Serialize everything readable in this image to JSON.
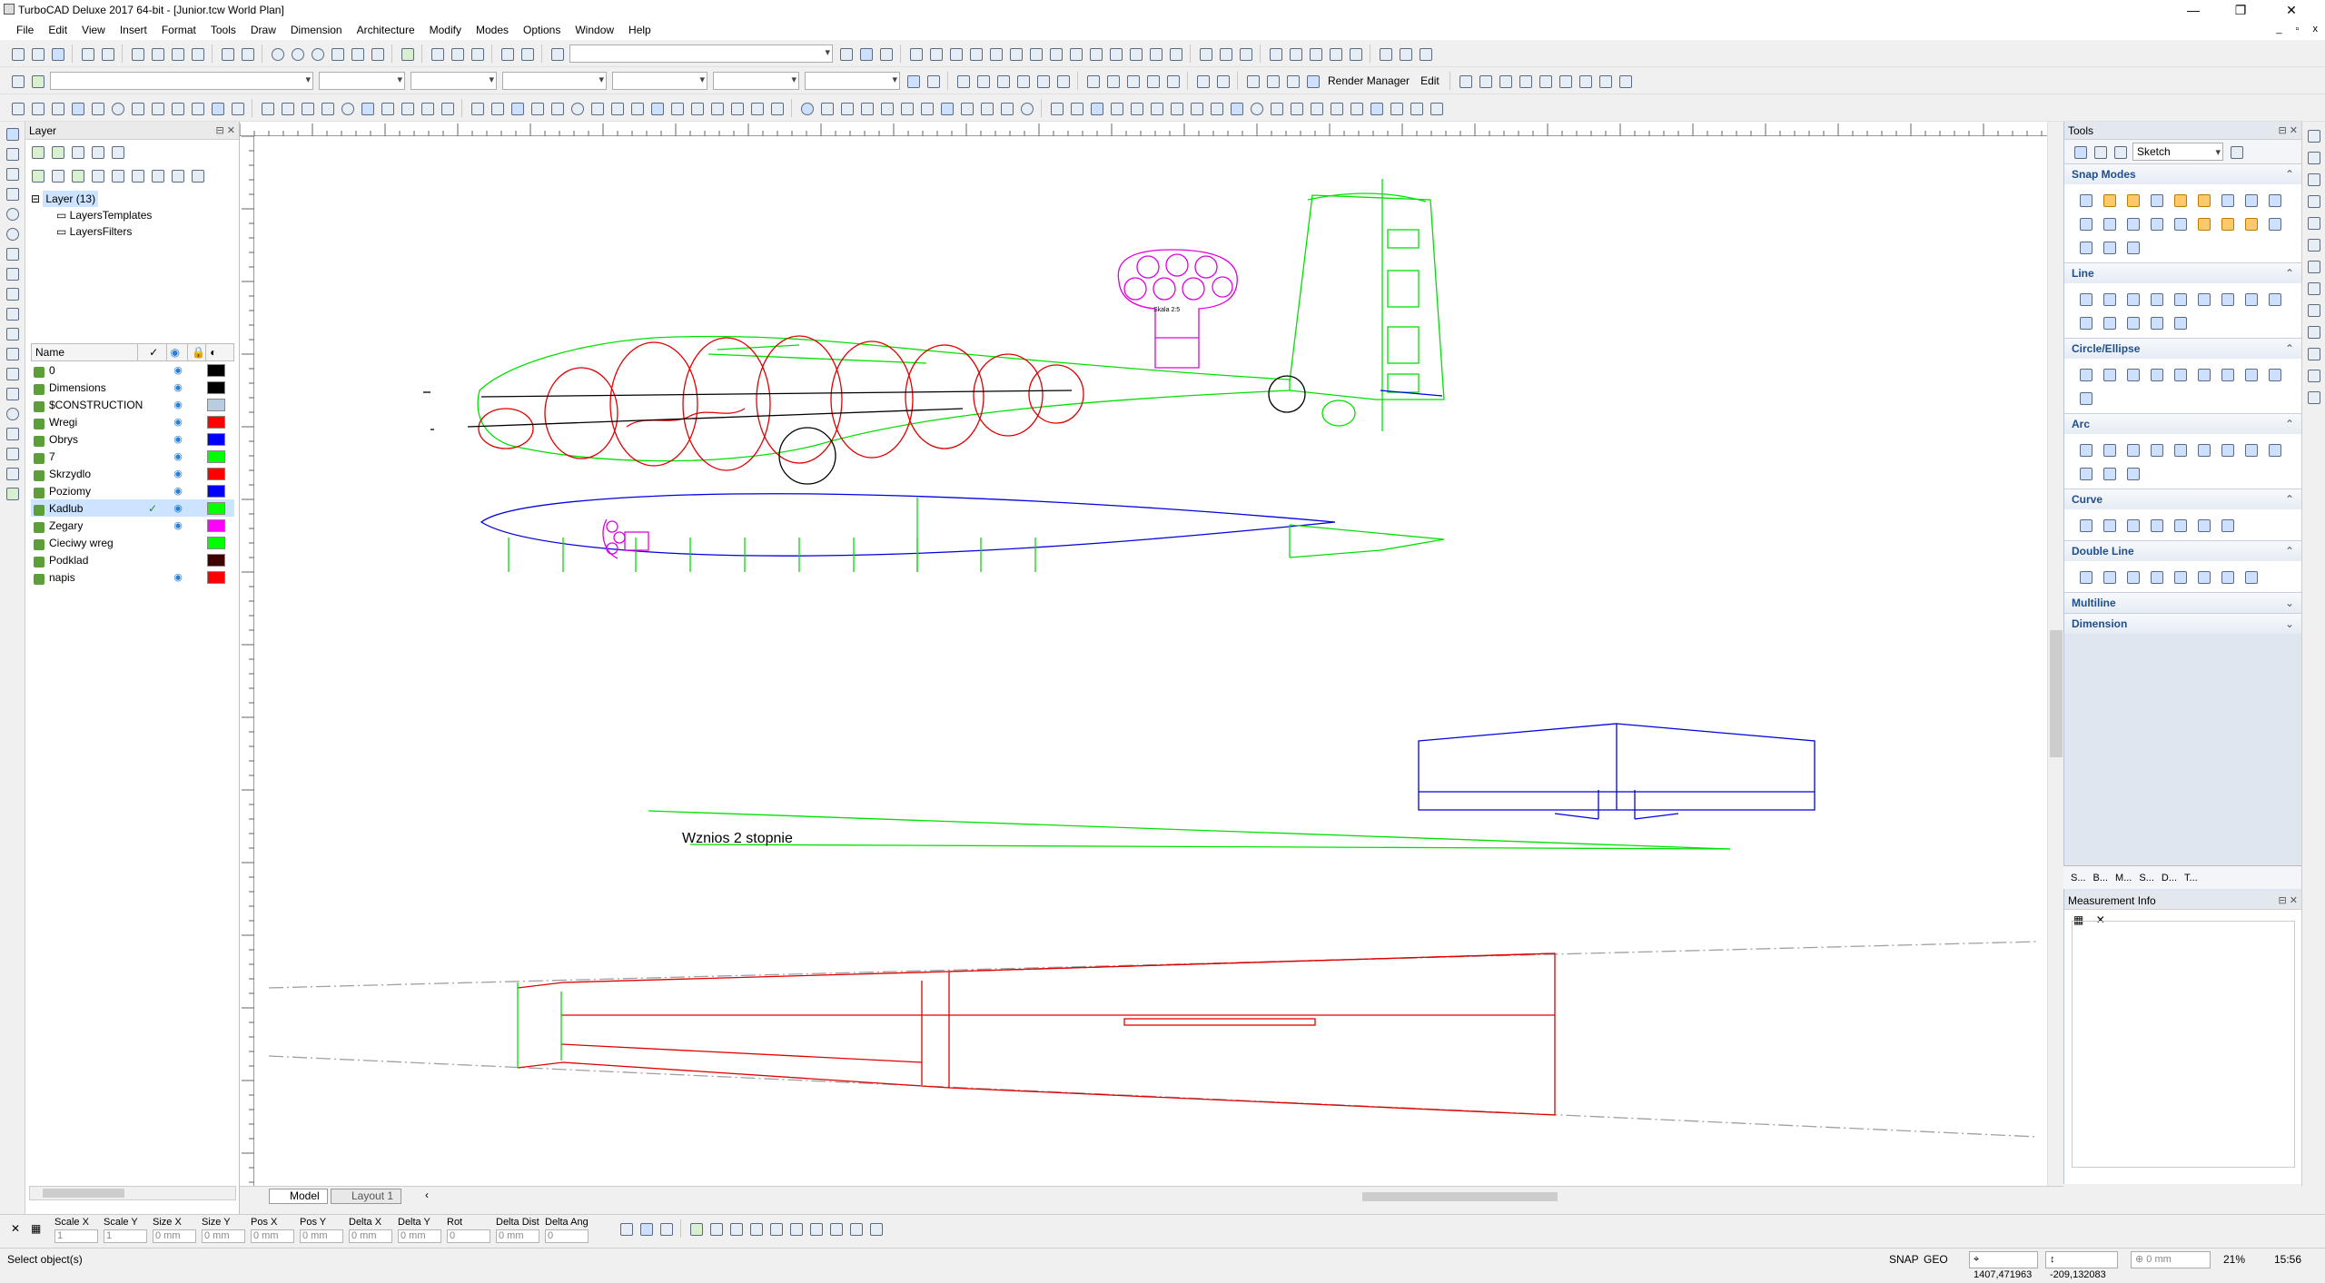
{
  "window": {
    "title": "TurboCAD Deluxe 2017 64-bit - [Junior.tcw World Plan]",
    "controls": {
      "minimize": "—",
      "restore": "❐",
      "close": "✕"
    },
    "mdi": {
      "minimize": "_",
      "restore": "▫",
      "close": "x"
    }
  },
  "menu": [
    "File",
    "Edit",
    "View",
    "Insert",
    "Format",
    "Tools",
    "Draw",
    "Dimension",
    "Architecture",
    "Modify",
    "Modes",
    "Options",
    "Window",
    "Help"
  ],
  "toolbar2": {
    "render_manager": "Render Manager",
    "edit": "Edit"
  },
  "layer_panel": {
    "title": "Layer",
    "tree": {
      "root": "Layer (13)",
      "children": [
        "LayersTemplates",
        "LayersFilters"
      ]
    },
    "column_name": "Name",
    "layers": [
      {
        "name": "0",
        "visible": true,
        "current": false,
        "color": "#000000"
      },
      {
        "name": "Dimensions",
        "visible": true,
        "current": false,
        "color": "#000000"
      },
      {
        "name": "$CONSTRUCTION",
        "visible": true,
        "current": false,
        "color": "#b9cde0"
      },
      {
        "name": "Wregi",
        "visible": true,
        "current": false,
        "color": "#ff0000"
      },
      {
        "name": "Obrys",
        "visible": true,
        "current": false,
        "color": "#0000ff"
      },
      {
        "name": "7",
        "visible": true,
        "current": false,
        "color": "#00ff00"
      },
      {
        "name": "Skrzydlo",
        "visible": true,
        "current": false,
        "color": "#ff0000"
      },
      {
        "name": "Poziomy",
        "visible": true,
        "current": false,
        "color": "#0000ff"
      },
      {
        "name": "Kadlub",
        "visible": true,
        "current": true,
        "color": "#00ff00"
      },
      {
        "name": "Zegary",
        "visible": true,
        "current": false,
        "color": "#ff00ff"
      },
      {
        "name": "Cieciwy wreg",
        "visible": false,
        "current": false,
        "color": "#00ff00"
      },
      {
        "name": "Podklad",
        "visible": false,
        "current": false,
        "color": "#400000"
      },
      {
        "name": "napis",
        "visible": true,
        "current": false,
        "color": "#ff0000"
      }
    ]
  },
  "drawing": {
    "text_annotation": "Wznios 2 stopnie",
    "panel_label": "Skala 2:5",
    "colors": {
      "green": "#00e000",
      "red": "#e00000",
      "blue": "#0000e0",
      "magenta": "#e000e0",
      "black": "#000000"
    }
  },
  "tabs": {
    "model": "Model",
    "layout": "Layout 1"
  },
  "tools_panel": {
    "title": "Tools",
    "mode_combo": "Sketch",
    "sections": [
      {
        "name": "Snap Modes",
        "expanded": true
      },
      {
        "name": "Line",
        "expanded": true
      },
      {
        "name": "Circle/Ellipse",
        "expanded": true
      },
      {
        "name": "Arc",
        "expanded": true
      },
      {
        "name": "Curve",
        "expanded": true
      },
      {
        "name": "Double Line",
        "expanded": true
      },
      {
        "name": "Multiline",
        "expanded": false
      },
      {
        "name": "Dimension",
        "expanded": false
      }
    ],
    "footer_tabs": [
      "S...",
      "B...",
      "M...",
      "S...",
      "D...",
      "T..."
    ]
  },
  "measurement_panel": {
    "title": "Measurement Info"
  },
  "inspector": {
    "fields": [
      {
        "label": "Scale X",
        "value": "1"
      },
      {
        "label": "Scale Y",
        "value": "1"
      },
      {
        "label": "Size X",
        "value": "0 mm"
      },
      {
        "label": "Size Y",
        "value": "0 mm"
      },
      {
        "label": "Pos X",
        "value": "0 mm"
      },
      {
        "label": "Pos Y",
        "value": "0 mm"
      },
      {
        "label": "Delta X",
        "value": "0 mm"
      },
      {
        "label": "Delta Y",
        "value": "0 mm"
      },
      {
        "label": "Rot",
        "value": "0"
      },
      {
        "label": "Delta Dist",
        "value": "0 mm"
      },
      {
        "label": "Delta Ang",
        "value": "0"
      }
    ]
  },
  "status": {
    "message": "Select object(s)",
    "snap": "SNAP",
    "geo": "GEO",
    "coord_x": "1407,471963",
    "coord_y": "-209,132083",
    "delta": "0 mm",
    "zoom": "21%",
    "time": "15:56"
  }
}
